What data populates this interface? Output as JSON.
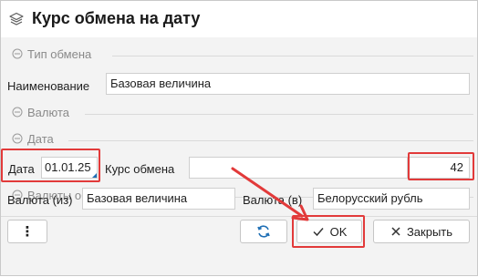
{
  "window": {
    "title": "Курс обмена на дату",
    "icon": "layers-icon"
  },
  "groups": {
    "exchange_type": "Тип обмена",
    "currency": "Валюта",
    "date": "Дата",
    "exchange_currencies": "Валюты обмена"
  },
  "fields": {
    "name_label": "Наименование",
    "name_value": "Базовая величина",
    "date_label": "Дата",
    "date_value": "01.01.25",
    "rate_label": "Курс обмена",
    "rate_extra": "",
    "rate_value": "42",
    "from_label": "Валюта (из)",
    "from_value": "Базовая величина",
    "to_label": "Валюта (в)",
    "to_value": "Белорусский рубль"
  },
  "buttons": {
    "more": "⋮",
    "refresh_icon": "refresh-icon",
    "ok": "OK",
    "close": "Закрыть"
  },
  "colors": {
    "highlight": "#e23a3a",
    "refresh": "#1f6fb5"
  }
}
